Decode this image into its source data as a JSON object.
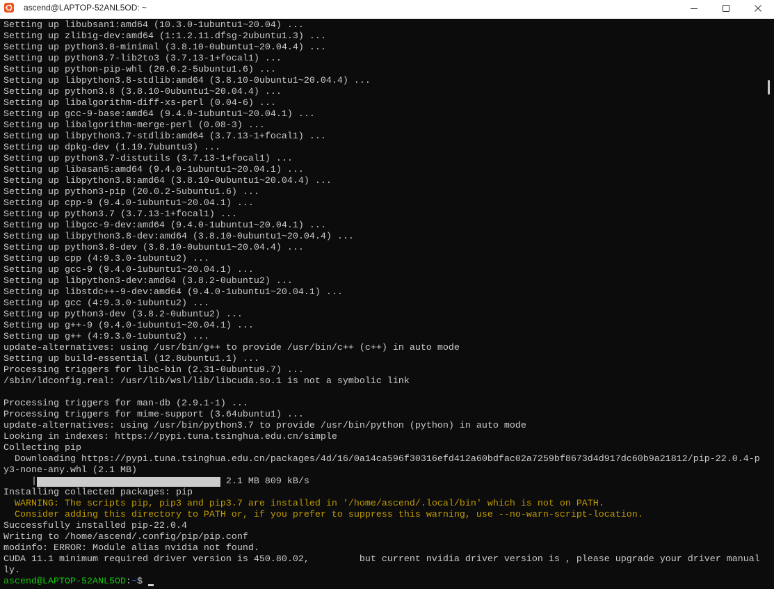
{
  "window": {
    "title": "ascend@LAPTOP-52ANL5OD: ~",
    "icon": "ubuntu-icon",
    "controls": {
      "minimize": "minimize-icon",
      "maximize": "maximize-icon",
      "close": "close-icon"
    }
  },
  "colors": {
    "background": "#0c0c0c",
    "foreground": "#cccccc",
    "warning": "#c19c00",
    "prompt_user": "#16c60c",
    "prompt_path": "#3b78ff",
    "titlebar_background": "#ffffff",
    "title_text": "#1f1f1f",
    "ubuntu_orange": "#e95420",
    "scrollbar_thumb": "#c8c8c8"
  },
  "terminal": {
    "scroll_position": 0.11,
    "lines": [
      {
        "text": "Setting up libubsan1:amd64 (10.3.0-1ubuntu1~20.04) ..."
      },
      {
        "text": "Setting up zlib1g-dev:amd64 (1:1.2.11.dfsg-2ubuntu1.3) ..."
      },
      {
        "text": "Setting up python3.8-minimal (3.8.10-0ubuntu1~20.04.4) ..."
      },
      {
        "text": "Setting up python3.7-lib2to3 (3.7.13-1+focal1) ..."
      },
      {
        "text": "Setting up python-pip-whl (20.0.2-5ubuntu1.6) ..."
      },
      {
        "text": "Setting up libpython3.8-stdlib:amd64 (3.8.10-0ubuntu1~20.04.4) ..."
      },
      {
        "text": "Setting up python3.8 (3.8.10-0ubuntu1~20.04.4) ..."
      },
      {
        "text": "Setting up libalgorithm-diff-xs-perl (0.04-6) ..."
      },
      {
        "text": "Setting up gcc-9-base:amd64 (9.4.0-1ubuntu1~20.04.1) ..."
      },
      {
        "text": "Setting up libalgorithm-merge-perl (0.08-3) ..."
      },
      {
        "text": "Setting up libpython3.7-stdlib:amd64 (3.7.13-1+focal1) ..."
      },
      {
        "text": "Setting up dpkg-dev (1.19.7ubuntu3) ..."
      },
      {
        "text": "Setting up python3.7-distutils (3.7.13-1+focal1) ..."
      },
      {
        "text": "Setting up libasan5:amd64 (9.4.0-1ubuntu1~20.04.1) ..."
      },
      {
        "text": "Setting up libpython3.8:amd64 (3.8.10-0ubuntu1~20.04.4) ..."
      },
      {
        "text": "Setting up python3-pip (20.0.2-5ubuntu1.6) ..."
      },
      {
        "text": "Setting up cpp-9 (9.4.0-1ubuntu1~20.04.1) ..."
      },
      {
        "text": "Setting up python3.7 (3.7.13-1+focal1) ..."
      },
      {
        "text": "Setting up libgcc-9-dev:amd64 (9.4.0-1ubuntu1~20.04.1) ..."
      },
      {
        "text": "Setting up libpython3.8-dev:amd64 (3.8.10-0ubuntu1~20.04.4) ..."
      },
      {
        "text": "Setting up python3.8-dev (3.8.10-0ubuntu1~20.04.4) ..."
      },
      {
        "text": "Setting up cpp (4:9.3.0-1ubuntu2) ..."
      },
      {
        "text": "Setting up gcc-9 (9.4.0-1ubuntu1~20.04.1) ..."
      },
      {
        "text": "Setting up libpython3-dev:amd64 (3.8.2-0ubuntu2) ..."
      },
      {
        "text": "Setting up libstdc++-9-dev:amd64 (9.4.0-1ubuntu1~20.04.1) ..."
      },
      {
        "text": "Setting up gcc (4:9.3.0-1ubuntu2) ..."
      },
      {
        "text": "Setting up python3-dev (3.8.2-0ubuntu2) ..."
      },
      {
        "text": "Setting up g++-9 (9.4.0-1ubuntu1~20.04.1) ..."
      },
      {
        "text": "Setting up g++ (4:9.3.0-1ubuntu2) ..."
      },
      {
        "text": "update-alternatives: using /usr/bin/g++ to provide /usr/bin/c++ (c++) in auto mode"
      },
      {
        "text": "Setting up build-essential (12.8ubuntu1.1) ..."
      },
      {
        "text": "Processing triggers for libc-bin (2.31-0ubuntu9.7) ..."
      },
      {
        "text": "/sbin/ldconfig.real: /usr/lib/wsl/lib/libcuda.so.1 is not a symbolic link"
      },
      {
        "text": ""
      },
      {
        "text": "Processing triggers for man-db (2.9.1-1) ..."
      },
      {
        "text": "Processing triggers for mime-support (3.64ubuntu1) ..."
      },
      {
        "text": "update-alternatives: using /usr/bin/python3.7 to provide /usr/bin/python (python) in auto mode"
      },
      {
        "text": "Looking in indexes: https://pypi.tuna.tsinghua.edu.cn/simple"
      },
      {
        "text": "Collecting pip"
      },
      {
        "text": "  Downloading https://pypi.tuna.tsinghua.edu.cn/packages/4d/16/0a14ca596f30316efd412a60bdfac02a7259bf8673d4d917dc60b9a21812/pip-22.0.4-p"
      },
      {
        "text": "y3-none-any.whl (2.1 MB)"
      },
      {
        "progress_bar": {
          "prefix": "     |",
          "fraction": 1.0,
          "suffix": " 2.1 MB 809 kB/s"
        }
      },
      {
        "text": "Installing collected packages: pip"
      },
      {
        "text": "  WARNING: The scripts pip, pip3 and pip3.7 are installed in '/home/ascend/.local/bin' which is not on PATH.",
        "warning": true
      },
      {
        "text": "  Consider adding this directory to PATH or, if you prefer to suppress this warning, use --no-warn-script-location.",
        "warning": true
      },
      {
        "text": "Successfully installed pip-22.0.4"
      },
      {
        "text": "Writing to /home/ascend/.config/pip/pip.conf"
      },
      {
        "text": "modinfo: ERROR: Module alias nvidia not found."
      },
      {
        "text": "CUDA 11.1 minimum required driver version is 450.80.02,         but current nvidia driver version is , please upgrade your driver manual"
      },
      {
        "text": "ly."
      },
      {
        "prompt": {
          "user_host": "ascend@LAPTOP-52ANL5OD",
          "separator": ":",
          "path": "~",
          "symbol": "$ "
        }
      }
    ]
  }
}
